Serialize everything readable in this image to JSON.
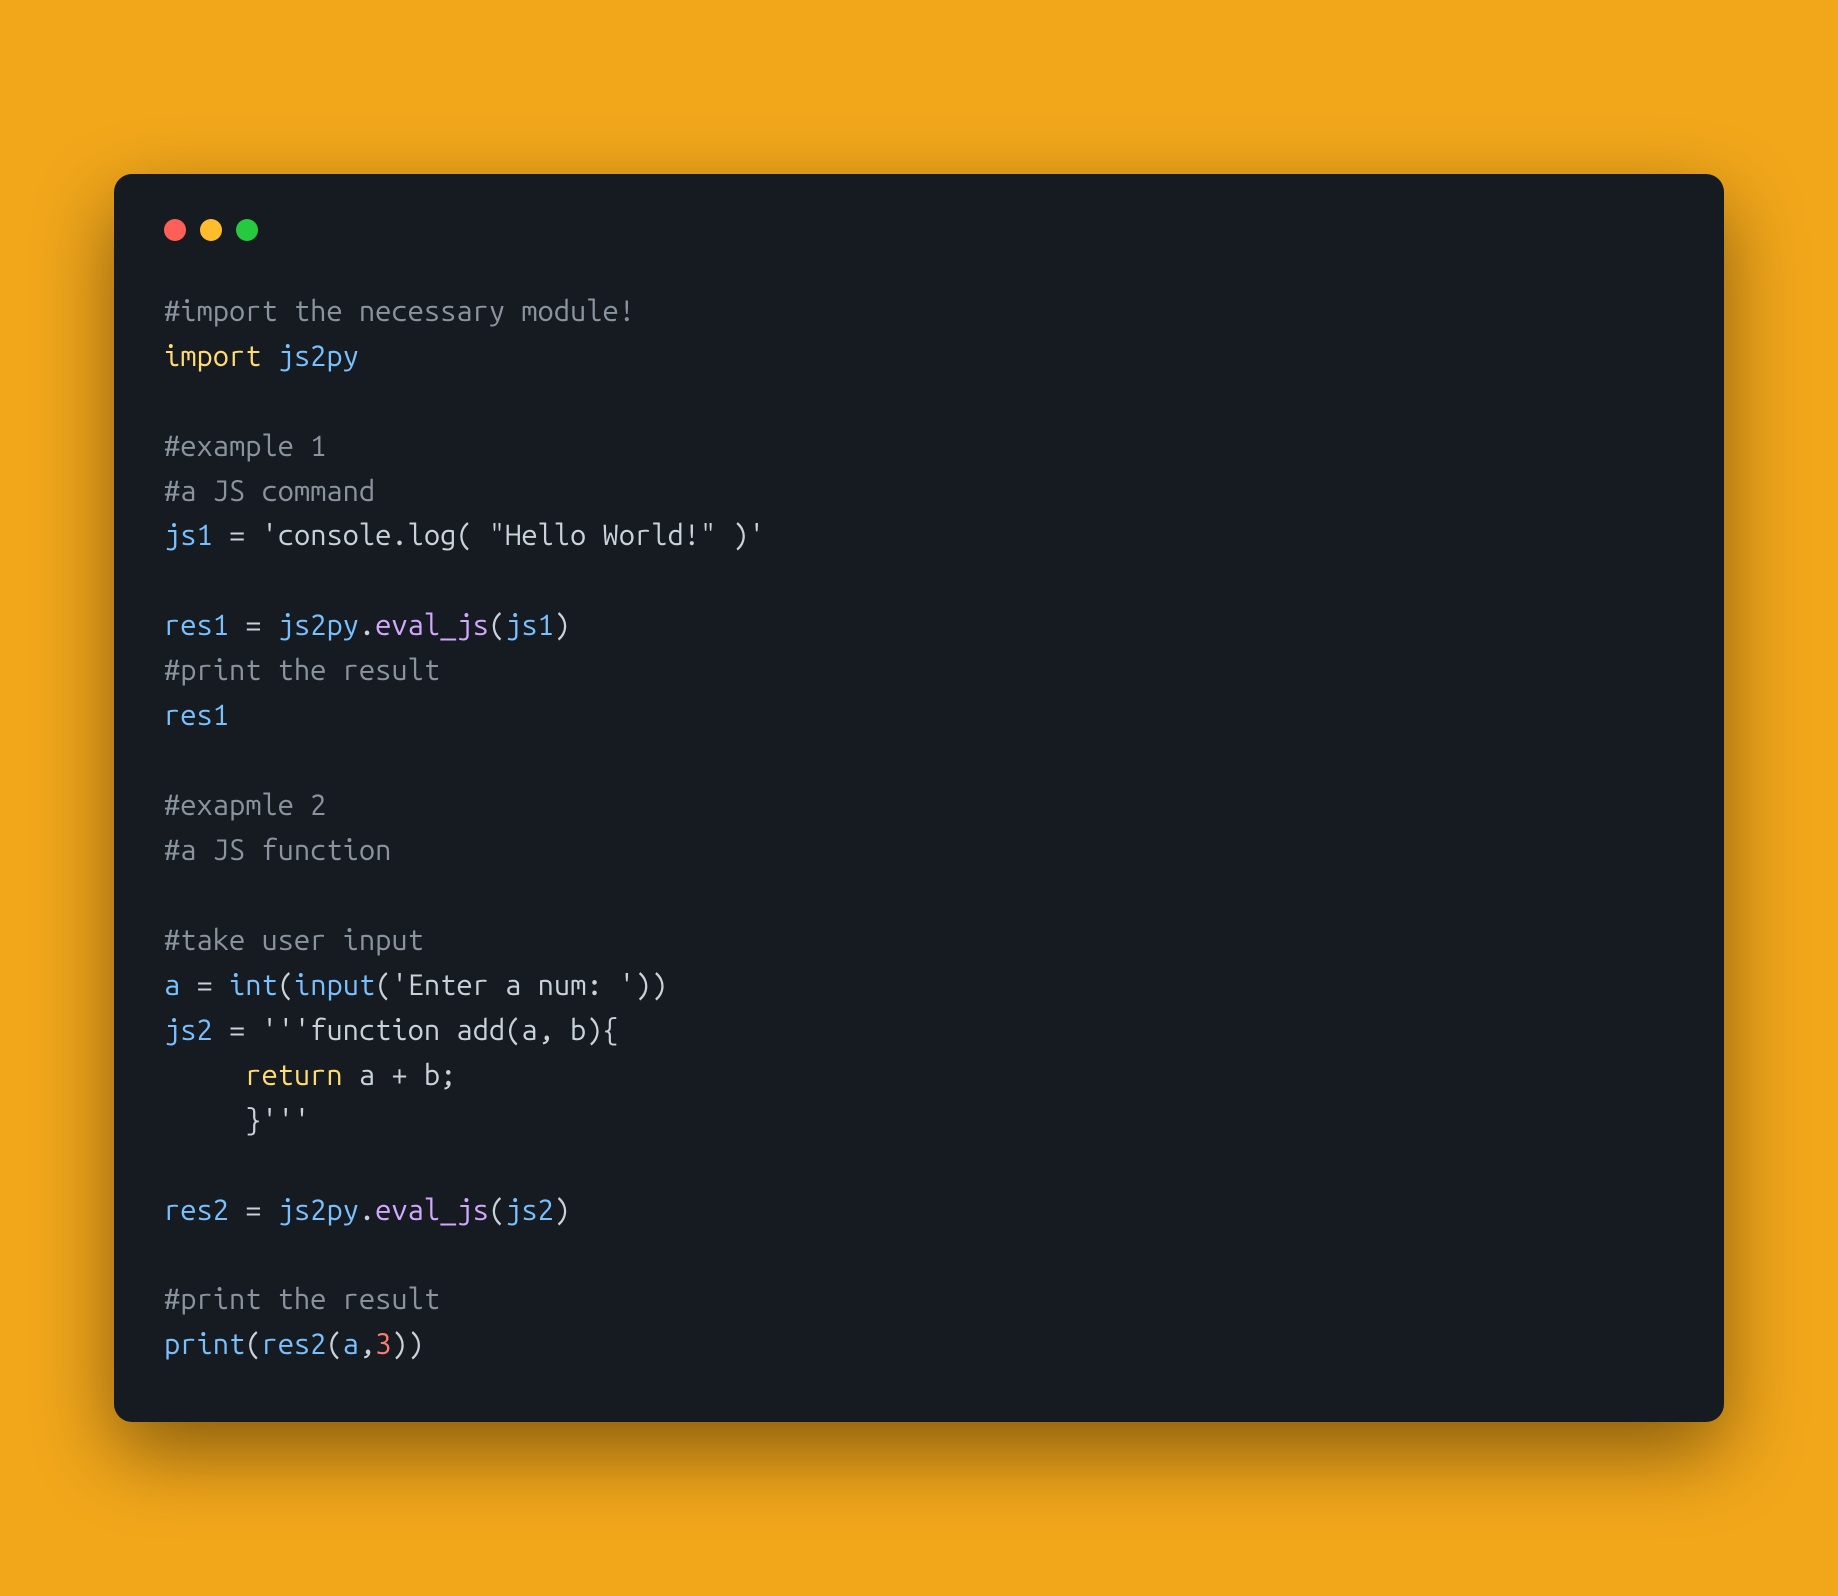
{
  "traffic": {
    "red": "close",
    "yellow": "minimize",
    "green": "maximize"
  },
  "code": {
    "l01_c1": "#import the necessary module!",
    "l02_kw": "import",
    "l02_sp": " ",
    "l02_mod": "js2py",
    "l03_blank": "",
    "l04_c1": "#example 1",
    "l05_c1": "#a JS command",
    "l06_var": "js1",
    "l06_sp1": " ",
    "l06_eq": "=",
    "l06_sp2": " ",
    "l06_str": "'console.log( \"Hello World!\" )'",
    "l07_blank": "",
    "l08_var": "res1",
    "l08_sp1": " ",
    "l08_eq": "=",
    "l08_sp2": " ",
    "l08_mod": "js2py",
    "l08_dot": ".",
    "l08_fn": "eval_js",
    "l08_lp": "(",
    "l08_arg": "js1",
    "l08_rp": ")",
    "l09_c1": "#print the result",
    "l10_var": "res1",
    "l11_blank": "",
    "l12_c1": "#exapmle 2",
    "l13_c1": "#a JS function",
    "l14_blank": "",
    "l15_c1": "#take user input",
    "l16_var": "a",
    "l16_sp1": " ",
    "l16_eq": "=",
    "l16_sp2": " ",
    "l16_int": "int",
    "l16_lp1": "(",
    "l16_input": "input",
    "l16_lp2": "(",
    "l16_str": "'Enter a num: '",
    "l16_rp2": ")",
    "l16_rp1": ")",
    "l17_var": "js2",
    "l17_sp1": " ",
    "l17_eq": "=",
    "l17_sp2": " ",
    "l17_str": "'''function add(a, b){",
    "l18_indent": "     ",
    "l18_kw": "return",
    "l18_rest": " a + b;",
    "l19_str": "     }'''",
    "l20_blank": "",
    "l21_var": "res2",
    "l21_sp1": " ",
    "l21_eq": "=",
    "l21_sp2": " ",
    "l21_mod": "js2py",
    "l21_dot": ".",
    "l21_fn": "eval_js",
    "l21_lp": "(",
    "l21_arg": "js2",
    "l21_rp": ")",
    "l22_blank": "",
    "l23_c1": "#print the result",
    "l24_print": "print",
    "l24_lp1": "(",
    "l24_res2": "res2",
    "l24_lp2": "(",
    "l24_a": "a",
    "l24_comma": ",",
    "l24_num": "3",
    "l24_rp2": ")",
    "l24_rp1": ")"
  }
}
